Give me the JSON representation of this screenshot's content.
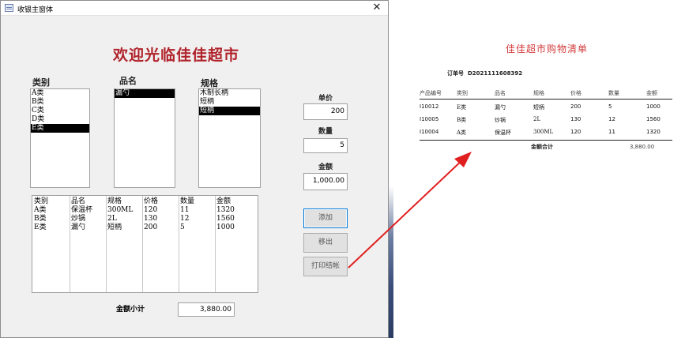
{
  "window": {
    "title": "收银主窗体",
    "close_glyph": "✕",
    "icon": "form-icon"
  },
  "form": {
    "welcome": "欢迎光临佳佳超市",
    "category_label": "类别",
    "product_label": "品名",
    "spec_label": "规格",
    "price_label": "单价",
    "quantity_label": "数量",
    "amount_label": "金额",
    "price_value": "200",
    "quantity_value": "5",
    "amount_value": "1,000.00",
    "categories": [
      "A类",
      "B类",
      "C类",
      "D类",
      "E类"
    ],
    "selected_category": "E类",
    "products": [
      "漏勺"
    ],
    "selected_product": "漏勺",
    "specs": [
      "木制长柄",
      "短柄",
      "短柄"
    ],
    "selected_spec_index": 2,
    "add_button": "添加",
    "remove_button": "移出",
    "print_button": "打印结帐",
    "cart_headers": [
      "类别",
      "品名",
      "规格",
      "价格",
      "数量",
      "金额"
    ],
    "cart_rows": [
      [
        "A类",
        "保温杯",
        "300ML",
        "120",
        "11",
        "1320"
      ],
      [
        "B类",
        "炒锅",
        "2L",
        "130",
        "12",
        "1560"
      ],
      [
        "E类",
        "漏勺",
        "短柄",
        "200",
        "5",
        "1000"
      ]
    ],
    "subtotal_label": "金额小计",
    "subtotal_value": "3,880.00"
  },
  "receipt": {
    "title": "佳佳超市购物清单",
    "order_label": "订单号",
    "order_number": "D2021111608392",
    "headers": [
      "产品编号",
      "类别",
      "品名",
      "规格",
      "价格",
      "数量",
      "金额"
    ],
    "rows": [
      [
        "I10012",
        "E类",
        "漏勺",
        "短柄",
        "200",
        "5",
        "1000"
      ],
      [
        "I10005",
        "B类",
        "炒锅",
        "2L",
        "130",
        "12",
        "1560"
      ],
      [
        "I10004",
        "A类",
        "保温杯",
        "300ML",
        "120",
        "11",
        "1320"
      ]
    ],
    "total_label": "金额合计",
    "total_value": "3,880.00"
  },
  "colors": {
    "welcome_text": "#b0222a",
    "receipt_title": "#d23b3b",
    "annotation_arrow": "#e02020",
    "selection": "#000000",
    "focus_border": "#0078d7"
  }
}
